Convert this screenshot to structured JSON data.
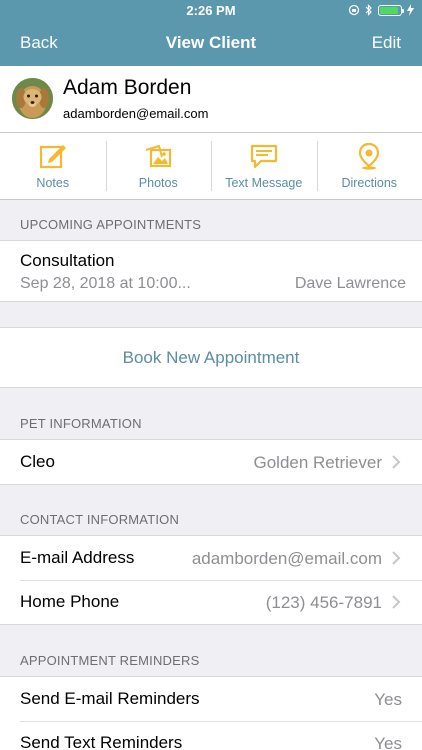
{
  "status_bar": {
    "time": "2:26 PM"
  },
  "navbar": {
    "back_label": "Back",
    "title": "View Client",
    "edit_label": "Edit"
  },
  "client": {
    "name": "Adam Borden",
    "email": "adamborden@email.com"
  },
  "actions": [
    {
      "label": "Notes",
      "icon": "pencil-note-icon"
    },
    {
      "label": "Photos",
      "icon": "photos-icon"
    },
    {
      "label": "Text Message",
      "icon": "message-icon"
    },
    {
      "label": "Directions",
      "icon": "location-pin-icon"
    }
  ],
  "colors": {
    "nav": "#5b97ad",
    "accent_icon": "#f5b82e",
    "link": "#5b8da3",
    "battery": "#4cd964"
  },
  "upcoming": {
    "header": "UPCOMING APPOINTMENTS",
    "appointment": {
      "type": "Consultation",
      "date": "Sep 28, 2018 at 10:00...",
      "staff": "Dave Lawrence"
    }
  },
  "book_button": "Book New Appointment",
  "pet_info": {
    "header": "PET INFORMATION",
    "pet": {
      "name": "Cleo",
      "breed": "Golden Retriever"
    }
  },
  "contact_info": {
    "header": "CONTACT INFORMATION",
    "rows": [
      {
        "label": "E-mail Address",
        "value": "adamborden@email.com"
      },
      {
        "label": "Home Phone",
        "value": "(123) 456-7891"
      }
    ]
  },
  "reminders": {
    "header": "APPOINTMENT REMINDERS",
    "rows": [
      {
        "label": "Send E-mail Reminders",
        "value": "Yes"
      },
      {
        "label": "Send Text Reminders",
        "value": "Yes"
      }
    ]
  }
}
